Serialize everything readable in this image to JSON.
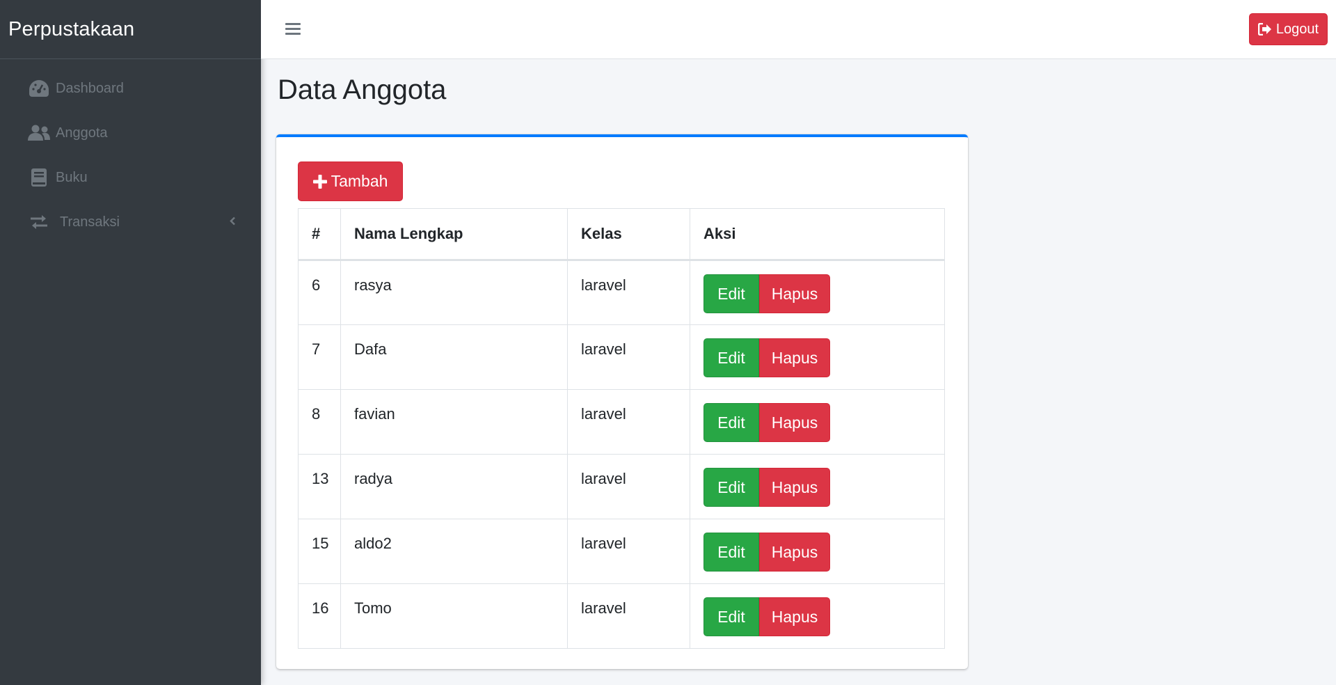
{
  "brand": {
    "title": "Perpustakaan"
  },
  "sidebar": {
    "items": [
      {
        "label": "Dashboard",
        "icon": "dashboard-gauge-icon"
      },
      {
        "label": "Anggota",
        "icon": "users-icon"
      },
      {
        "label": "Buku",
        "icon": "book-icon"
      },
      {
        "label": "Transaksi",
        "icon": "exchange-arrows-icon",
        "has_submenu": true
      }
    ]
  },
  "header": {
    "logout_label": "Logout"
  },
  "main": {
    "title": "Data Anggota",
    "add_button_label": "Tambah",
    "table": {
      "columns": [
        "#",
        "Nama Lengkap",
        "Kelas",
        "Aksi"
      ],
      "rows": [
        {
          "no": "6",
          "nama": "rasya",
          "kelas": "laravel"
        },
        {
          "no": "7",
          "nama": "Dafa",
          "kelas": "laravel"
        },
        {
          "no": "8",
          "nama": "favian",
          "kelas": "laravel"
        },
        {
          "no": "13",
          "nama": "radya",
          "kelas": "laravel"
        },
        {
          "no": "15",
          "nama": "aldo2",
          "kelas": "laravel"
        },
        {
          "no": "16",
          "nama": "Tomo",
          "kelas": "laravel"
        }
      ],
      "edit_label": "Edit",
      "delete_label": "Hapus"
    }
  },
  "colors": {
    "sidebar_bg": "#343a40",
    "danger": "#dc3545",
    "success": "#28a745",
    "primary": "#007bff",
    "content_bg": "#f4f6f9"
  }
}
